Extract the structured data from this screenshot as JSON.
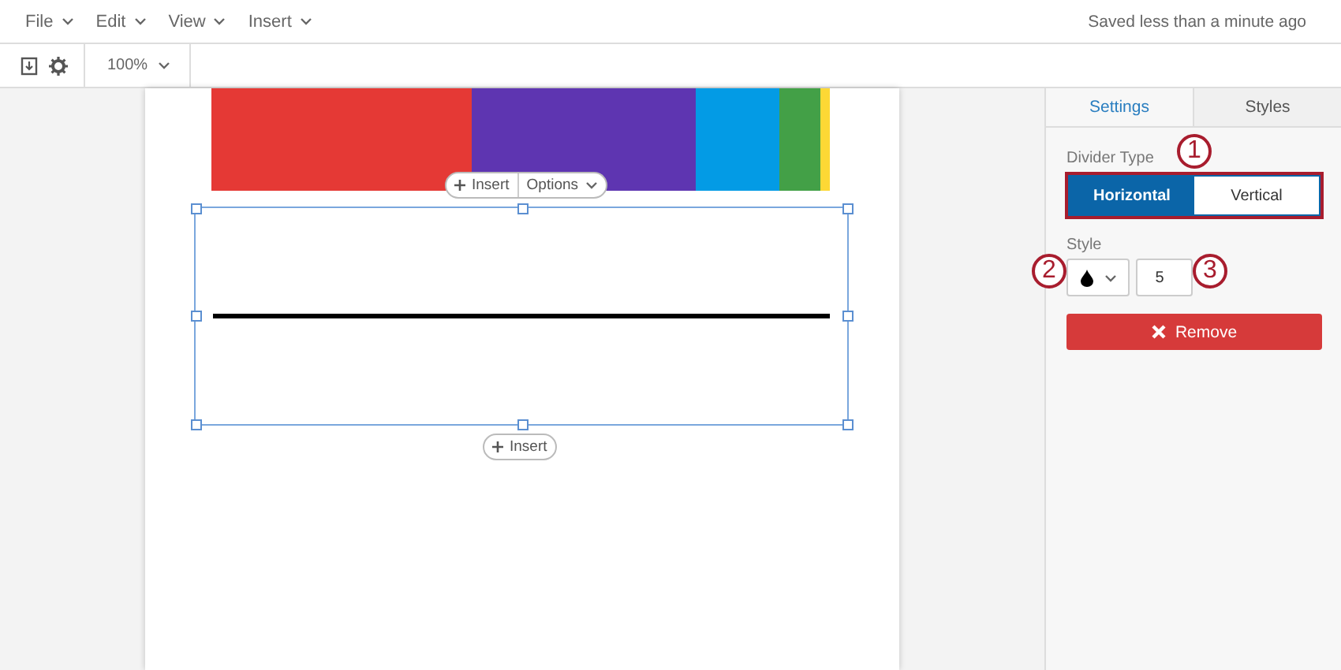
{
  "menu": [
    {
      "label": "File"
    },
    {
      "label": "Edit"
    },
    {
      "label": "View"
    },
    {
      "label": "Insert"
    }
  ],
  "save_status": "Saved less than a minute ago",
  "toolbar": {
    "zoom": "100%"
  },
  "canvas": {
    "insert_label": "Insert",
    "options_label": "Options",
    "bottom_insert_label": "Insert"
  },
  "panel": {
    "tabs": [
      {
        "label": "Settings",
        "selected": true
      },
      {
        "label": "Styles",
        "selected": false
      }
    ],
    "divider_type": {
      "label": "Divider Type",
      "options": [
        {
          "label": "Horizontal",
          "selected": true
        },
        {
          "label": "Vertical",
          "selected": false
        }
      ]
    },
    "style": {
      "label": "Style",
      "width_value": "5"
    },
    "remove_button": "Remove"
  },
  "annotations": [
    "1",
    "2",
    "3"
  ]
}
